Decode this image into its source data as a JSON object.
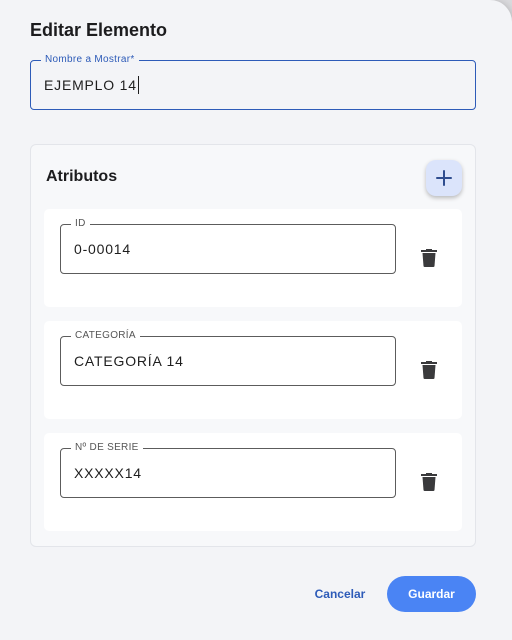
{
  "dialog": {
    "title": "Editar Elemento",
    "display_name": {
      "label": "Nombre a Mostrar*",
      "value": "EJEMPLO 14"
    },
    "attributes": {
      "title": "Atributos",
      "add_icon": "plus-icon",
      "items": [
        {
          "label": "ID",
          "value": "0-00014",
          "delete_icon": "trash-icon"
        },
        {
          "label": "CATEGORÍA",
          "value": "CATEGORÍA 14",
          "delete_icon": "trash-icon"
        },
        {
          "label": "Nº DE SERIE",
          "value": "XXXXX14",
          "delete_icon": "trash-icon"
        }
      ]
    },
    "actions": {
      "cancel": "Cancelar",
      "save": "Guardar"
    }
  },
  "colors": {
    "accent": "#2d5bb8",
    "primary_button": "#4a84f4",
    "add_button_bg": "#dbe4fb"
  }
}
